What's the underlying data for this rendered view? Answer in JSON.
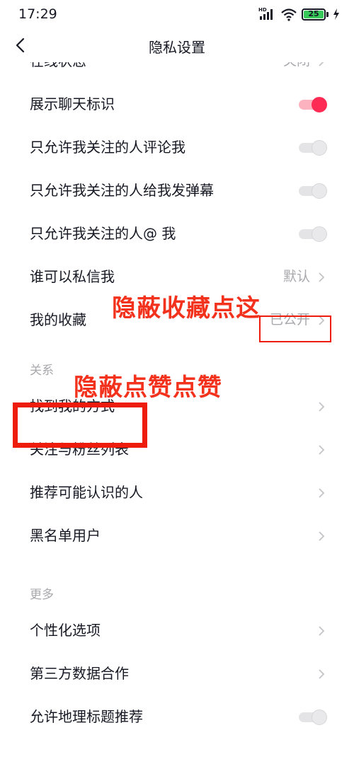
{
  "status": {
    "time": "17:29",
    "network": "HD",
    "battery": "25"
  },
  "nav": {
    "title": "隐私设置"
  },
  "rows": {
    "online_status": {
      "label": "在线状态",
      "value": "关闭"
    },
    "show_chat_badge": {
      "label": "展示聊天标识",
      "on": true
    },
    "comment_only_following": {
      "label": "只允许我关注的人评论我",
      "on": false
    },
    "danmaku_only_following": {
      "label": "只允许我关注的人给我发弹幕",
      "on": false
    },
    "mention_only_following": {
      "label": "只允许我关注的人@ 我",
      "on": false
    },
    "who_can_message": {
      "label": "谁可以私信我",
      "value": "默认"
    },
    "my_favorites": {
      "label": "我的收藏",
      "value": "已公开"
    }
  },
  "sections": {
    "relations": {
      "header": "关系",
      "items": [
        "找到我的方式",
        "关注与粉丝列表",
        "推荐可能认识的人",
        "黑名单用户"
      ]
    },
    "more": {
      "header": "更多",
      "items": [
        "个性化选项",
        "第三方数据合作"
      ],
      "geo_toggle": {
        "label": "允许地理标题推荐",
        "on": false
      }
    }
  },
  "annotations": {
    "hide_favorites": "隐蔽收藏点这",
    "hide_likes": "隐蔽点赞点赞",
    "color": "#f2321d"
  },
  "colors": {
    "accent": "#fe2c55",
    "text": "#161823",
    "secondary": "#a8a8ad"
  }
}
